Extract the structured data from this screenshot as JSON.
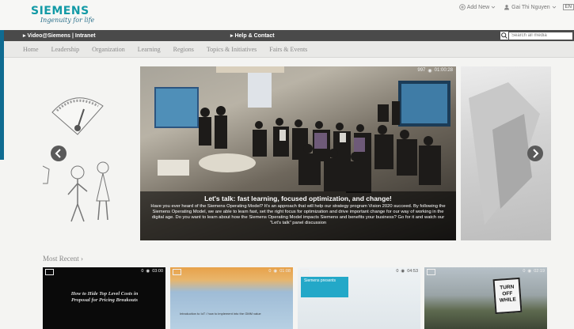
{
  "header": {
    "logo": "SIEMENS",
    "tagline": "Ingenuity for life",
    "add_new_label": "Add New",
    "user_name": "Gai Thi Nguyen",
    "language": "EN"
  },
  "topbar": {
    "video_link": "Video@Siemens | Intranet",
    "help_link": "Help & Contact",
    "search_placeholder": "Search all media"
  },
  "nav": {
    "items": [
      "Home",
      "Leadership",
      "Organization",
      "Learning",
      "Regions",
      "Topics & Initiatives",
      "Fairs & Events"
    ]
  },
  "carousel": {
    "slide_meta": {
      "views": "997",
      "duration": "01:00:28"
    },
    "title": "Let's talk: fast learning, focused optimization, and change!",
    "text": "Have you ever heard of the Siemens Operating Model? It's an approach that will help our strategy program Vision 2020 succeed. By following the Siemens Operating Model, we are able to learn fast, set the right focus for optimization and drive important change for our way of working in the digital age. Do you want to learn about how the Siemens Operating Model impacts Siemens and benefits your business? Go for it and watch our \"Let's talk\" panel discussion"
  },
  "most_recent": {
    "label": "Most Recent",
    "videos": [
      {
        "views": "0",
        "duration": "03:00",
        "title_text": "How to Hide Top Level Costs in Proposal for Pricing Breakouts"
      },
      {
        "views": "0",
        "duration": "01:08",
        "title_text": "Introduction to IoT / how to implement into the GMM value"
      },
      {
        "views": "0",
        "duration": "04:53",
        "title_text": "Siemens presents"
      },
      {
        "views": "0",
        "duration": "02:19",
        "title_text": "TURN OFF WHILE"
      }
    ]
  },
  "colors": {
    "brand_teal": "#129aa6",
    "topbar_bg": "#4a4a4a",
    "accent_blue": "#23a8c8"
  }
}
